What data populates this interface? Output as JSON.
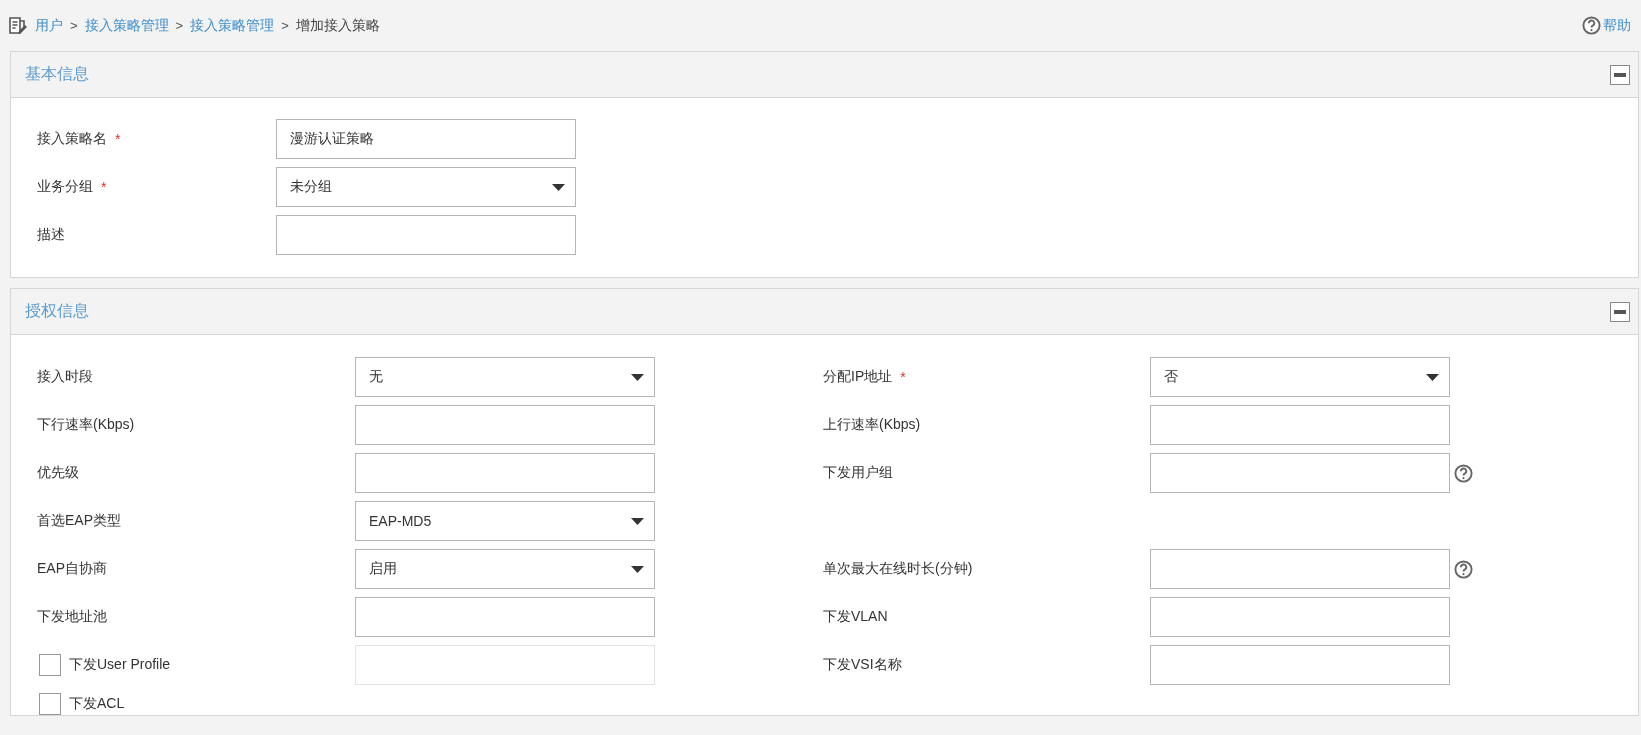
{
  "breadcrumb": [
    {
      "label": "用户",
      "kind": "link"
    },
    {
      "label": ">",
      "kind": "separator"
    },
    {
      "label": "接入策略管理",
      "kind": "link"
    },
    {
      "label": ">",
      "kind": "separator"
    },
    {
      "label": "接入策略管理",
      "kind": "link"
    },
    {
      "label": ">",
      "kind": "separator"
    },
    {
      "label": "增加接入策略",
      "kind": "current"
    }
  ],
  "help_link": {
    "label": "帮助"
  },
  "sections": [
    {
      "title": "基本信息",
      "expanded": true,
      "rows": [
        [
          {
            "label": "接入策略名",
            "required_mark": "*",
            "kind": "text",
            "value": "漫游认证策略"
          }
        ],
        [
          {
            "label": "业务分组",
            "required_mark": "*",
            "kind": "select",
            "value": "未分组"
          }
        ],
        [
          {
            "label": "描述",
            "kind": "text"
          }
        ]
      ]
    },
    {
      "title": "授权信息",
      "expanded": true,
      "rows": [
        [
          {
            "label": "接入时段",
            "kind": "select",
            "value": "无"
          },
          {
            "label": "分配IP地址",
            "required_mark": "*",
            "kind": "select",
            "value": "否"
          }
        ],
        [
          {
            "label": "下行速率(Kbps)",
            "kind": "text"
          },
          {
            "label": "上行速率(Kbps)",
            "kind": "text"
          }
        ],
        [
          {
            "label": "优先级",
            "kind": "text"
          },
          {
            "label": "下发用户组",
            "kind": "text",
            "help": true
          }
        ],
        [
          {
            "label": "首选EAP类型",
            "kind": "select",
            "value": "EAP-MD5"
          }
        ],
        [
          {
            "label": "EAP自协商",
            "kind": "select",
            "value": "启用"
          },
          {
            "label": "单次最大在线时长(分钟)",
            "kind": "text",
            "help": true
          }
        ],
        [
          {
            "label": "下发地址池",
            "kind": "text"
          },
          {
            "label": "下发VLAN",
            "kind": "text"
          }
        ],
        [
          {
            "label": "下发User Profile",
            "kind": "checkbox-text",
            "checked": false,
            "disabled": true
          },
          {
            "label": "下发VSI名称",
            "kind": "text"
          }
        ],
        [
          {
            "label": "下发ACL",
            "kind": "checkbox",
            "checked": false
          }
        ]
      ]
    }
  ]
}
